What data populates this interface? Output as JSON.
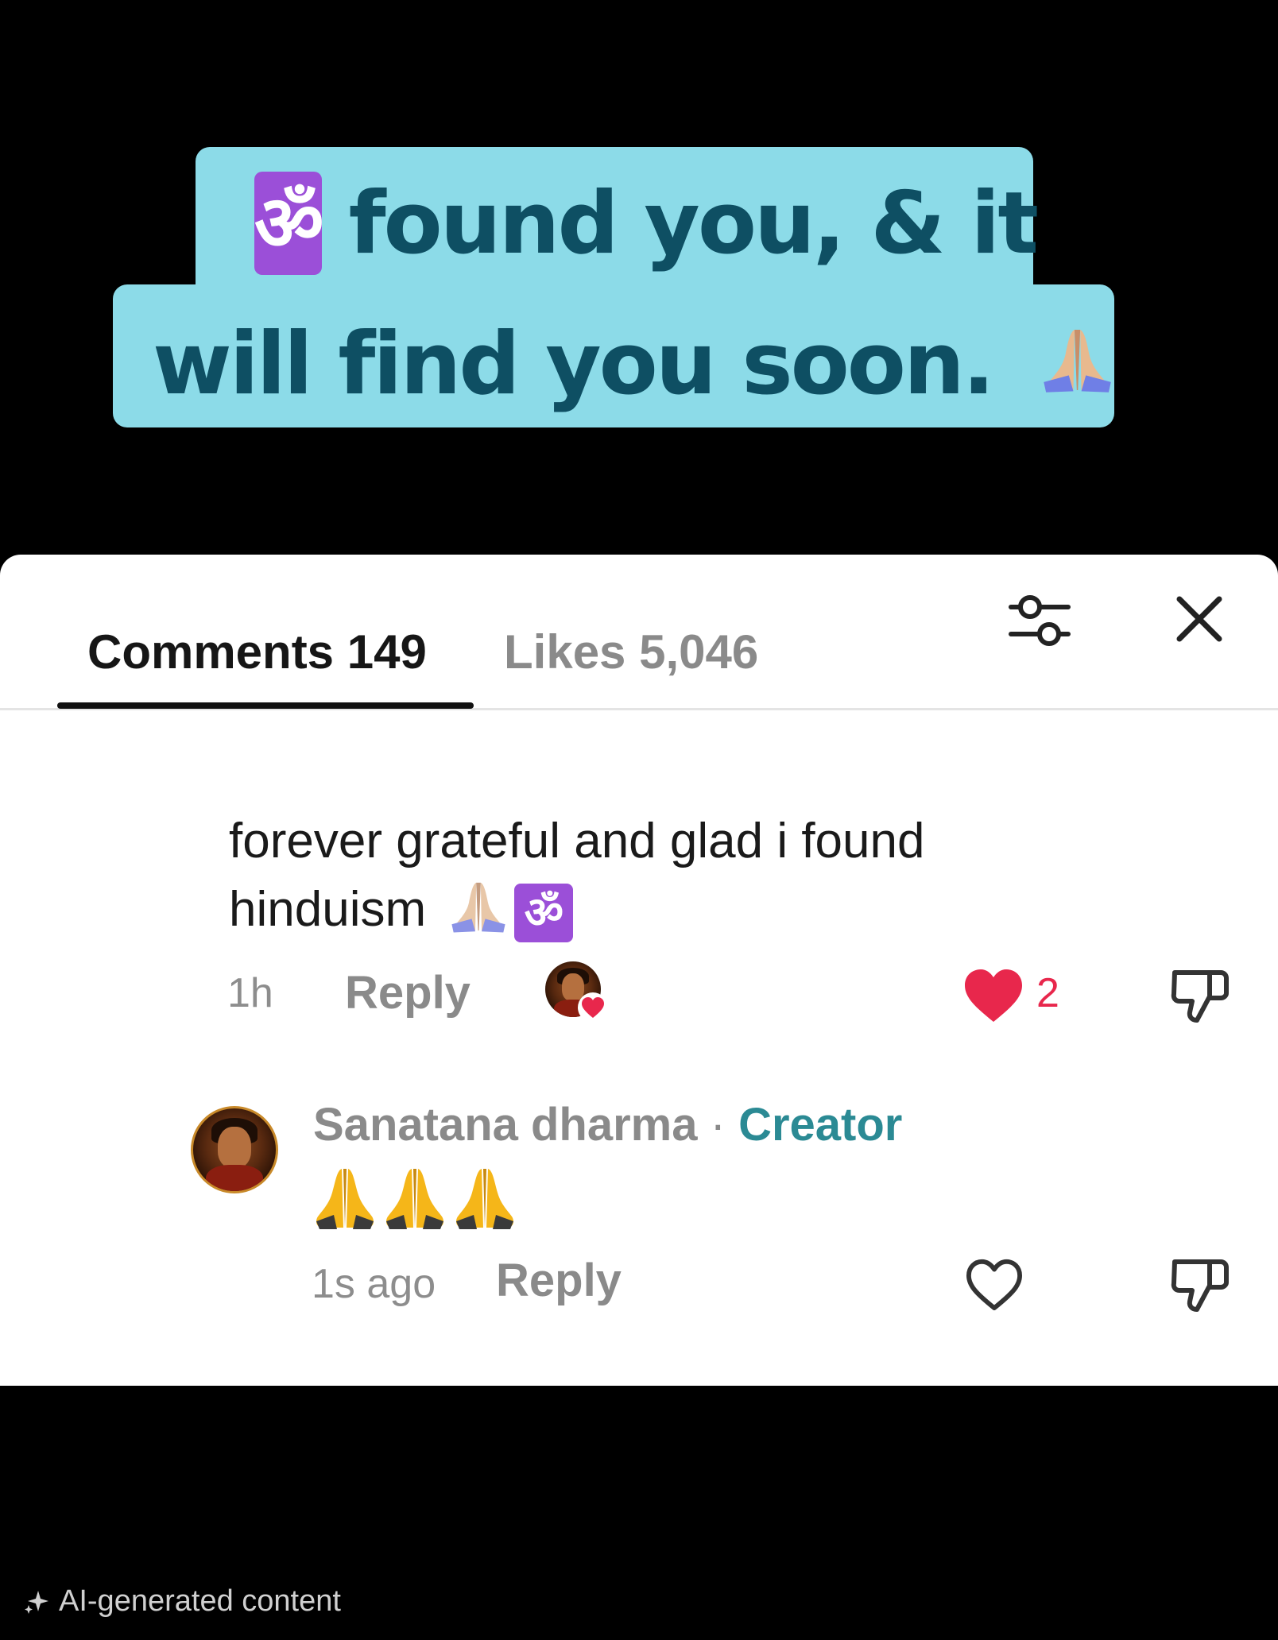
{
  "caption": {
    "line1_text": "found you, & it",
    "line2_text": "will find you soon.",
    "om_symbol": "ॐ",
    "icons": [
      "om-icon",
      "praying-hands-icon"
    ],
    "background_color": "#8cdbe8",
    "text_color": "#0e4f63"
  },
  "tabs": {
    "comments_label": "Comments 149",
    "likes_label": "Likes 5,046",
    "active": "Comments"
  },
  "header_icons": [
    "filter-sliders-icon",
    "close-icon"
  ],
  "comment": {
    "text": "forever grateful and glad i found hinduism",
    "emojis": [
      "praying-hands-icon",
      "om-icon"
    ],
    "om_symbol": "ॐ",
    "time": "1h",
    "reply_label": "Reply",
    "liked_by_creator": true,
    "like_count": "2",
    "liked": true,
    "like_color": "#e8274c"
  },
  "reply": {
    "author": "Sanatana dharma",
    "separator": " · ",
    "badge": "Creator",
    "badge_color": "#2b8a94",
    "text_emojis": [
      "folded-hands-icon",
      "folded-hands-icon",
      "folded-hands-icon"
    ],
    "time": "1s ago",
    "reply_label": "Reply",
    "liked": false
  },
  "footer": {
    "ai_label": "AI-generated content",
    "icon": "sparkle-icon"
  }
}
